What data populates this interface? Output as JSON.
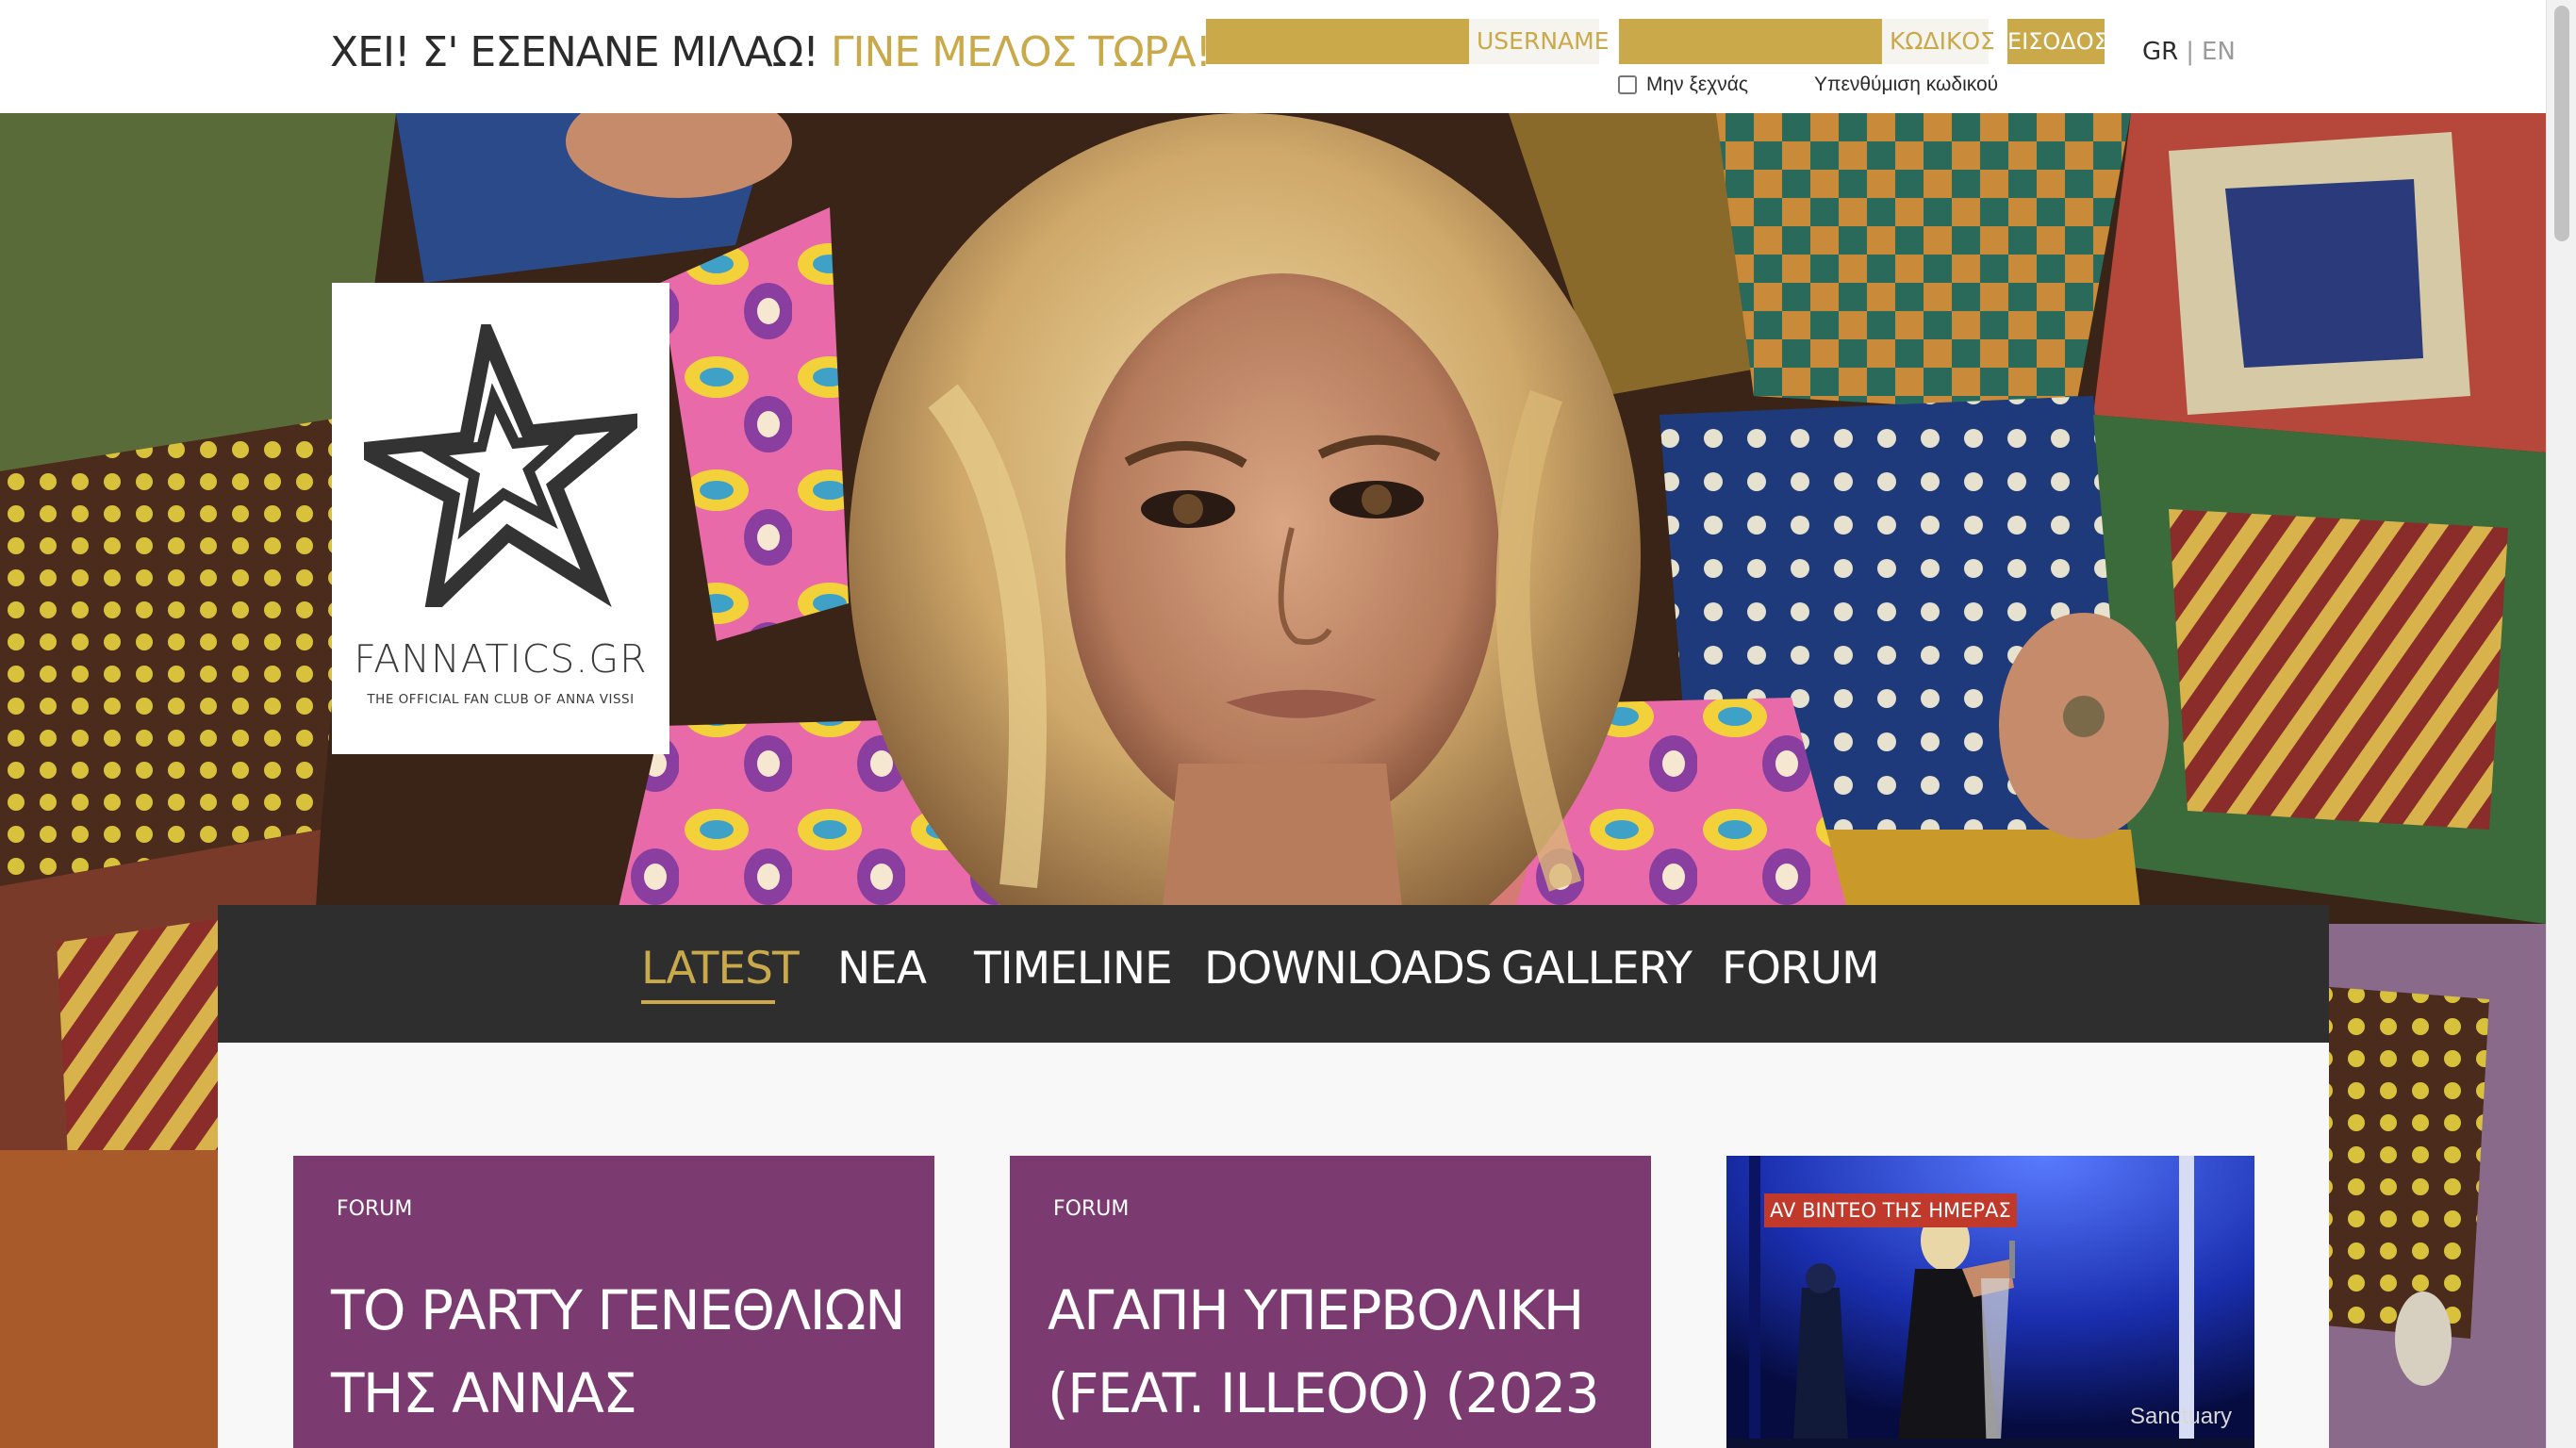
{
  "topbar": {
    "tagline_main": "ΧΕΙ! Σ' ΕΣΕΝΑΝΕ ΜΙΛΑΩ!",
    "tagline_cta": "ΓΙΝΕ ΜΕΛΟΣ ΤΩΡΑ!",
    "username_placeholder": "USERNAME",
    "password_placeholder": "ΚΩΔΙΚΟΣ",
    "login_label": "ΕΙΣΟΔΟΣ",
    "remember_label": "Μην ξεχνάς",
    "forgot_label": "Υπενθύμιση κωδικού",
    "lang_gr": "GR",
    "lang_sep": "|",
    "lang_en": "EN"
  },
  "logo": {
    "name": "FANNATICS.GR",
    "subtitle": "THE OFFICIAL FAN CLUB OF ANNA VISSI",
    "icon": "star-icon"
  },
  "nav": {
    "items": [
      {
        "label": "LATEST",
        "active": true
      },
      {
        "label": "ΝΕΑ",
        "active": false
      },
      {
        "label": "TIMELINE",
        "active": false
      },
      {
        "label": "DOWNLOADS",
        "active": false
      },
      {
        "label": "GALLERY",
        "active": false
      },
      {
        "label": "FORUM",
        "active": false
      }
    ]
  },
  "cards": [
    {
      "category": "FORUM",
      "title": "ΤΟ PARTY ΓΕΝΕΘΛΙΩΝ ΤΗΣ ΑΝΝΑΣ"
    },
    {
      "category": "FORUM",
      "title": "ΑΓΑΠΗ ΥΠΕΡΒΟΛΙΚΗ (FEAT. ILLEOO) (2023"
    }
  ],
  "video": {
    "badge": "AV ΒΙΝΤΕΟ ΤΗΣ ΗΜΕΡΑΣ",
    "caption": "Sanctuary"
  },
  "colors": {
    "gold": "#c9a94a",
    "nav_bg": "#2e2e2e",
    "card_purple": "#7b3b70",
    "badge_red": "#c0392b",
    "text_dark": "#2b2b2b"
  }
}
